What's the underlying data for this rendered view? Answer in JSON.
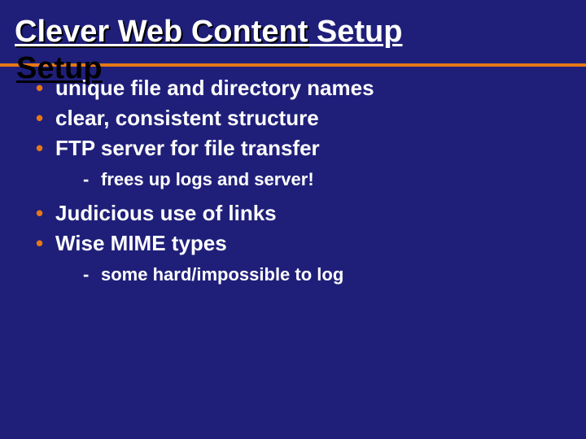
{
  "title": "Clever Web Content Setup",
  "bullets": [
    {
      "text": "unique file and directory names",
      "sub": []
    },
    {
      "text": "clear, consistent structure",
      "sub": []
    },
    {
      "text": "FTP server for file transfer",
      "sub": [
        "frees up logs and server!"
      ]
    },
    {
      "text": "Judicious use of links",
      "sub": []
    },
    {
      "text": "Wise MIME types",
      "sub": [
        "some hard/impossible to log"
      ]
    }
  ],
  "colors": {
    "background": "#1f1f7a",
    "accent": "#e67817",
    "text": "#ffffff"
  }
}
